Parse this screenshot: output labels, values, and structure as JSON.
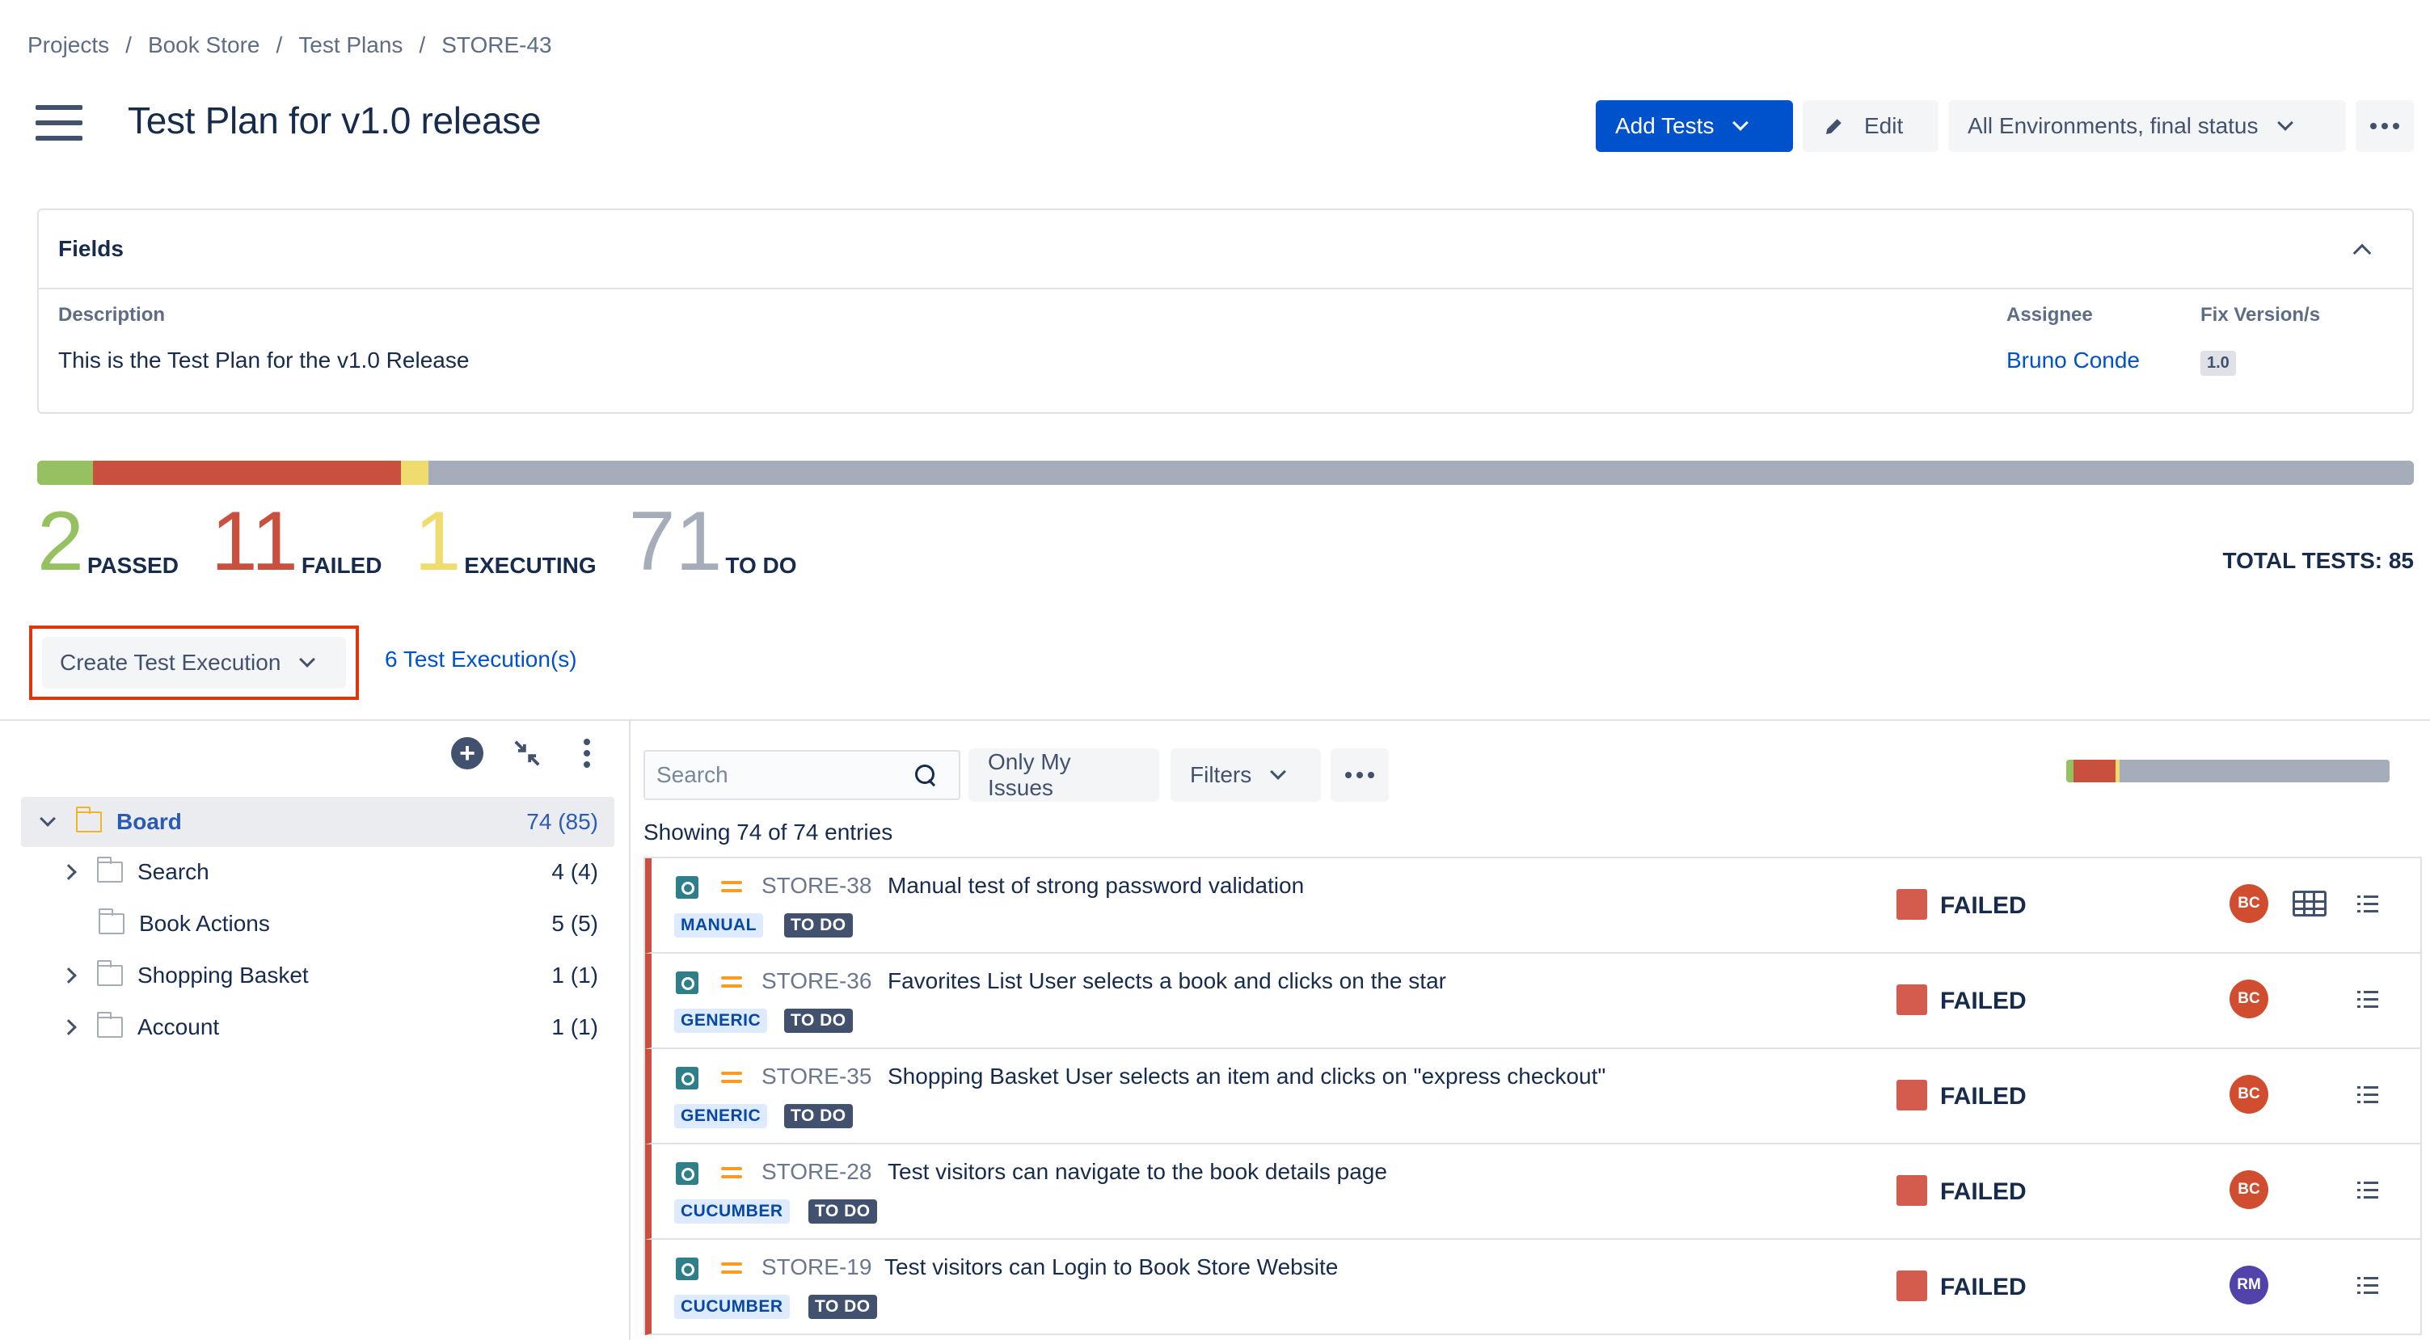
{
  "breadcrumb": {
    "items": [
      "Projects",
      "Book Store",
      "Test Plans",
      "STORE-43"
    ],
    "separator": "/"
  },
  "header": {
    "title": "Test Plan for v1.0 release",
    "add_tests_label": "Add Tests",
    "edit_label": "Edit",
    "environment_select": "All Environments, final status"
  },
  "fields": {
    "title": "Fields",
    "description_label": "Description",
    "description_value": "This is the Test Plan for the v1.0 Release",
    "assignee_label": "Assignee",
    "assignee_value": "Bruno Conde",
    "fix_version_label": "Fix Version/s",
    "fix_version_value": "1.0"
  },
  "summary": {
    "passed_count": "2",
    "passed_label": "PASSED",
    "failed_count": "11",
    "failed_label": "FAILED",
    "executing_count": "1",
    "executing_label": "EXECUTING",
    "todo_count": "71",
    "todo_label": "TO DO",
    "total_label": "TOTAL TESTS: 85",
    "colors": {
      "passed": "#95c160",
      "failed": "#c9503f",
      "executing": "#f0dc6e",
      "todo": "#a5adba"
    }
  },
  "executions": {
    "create_label": "Create Test Execution",
    "count_link": "6 Test Execution(s)"
  },
  "tree": {
    "items": [
      {
        "label": "Board",
        "count": "74 (85)",
        "expandable": true,
        "expanded": true
      },
      {
        "label": "Search",
        "count": "4 (4)",
        "expandable": true,
        "expanded": false
      },
      {
        "label": "Book Actions",
        "count": "5 (5)",
        "expandable": false,
        "expanded": false
      },
      {
        "label": "Shopping Basket",
        "count": "1 (1)",
        "expandable": true,
        "expanded": false
      },
      {
        "label": "Account",
        "count": "1 (1)",
        "expandable": true,
        "expanded": false
      }
    ]
  },
  "tests_toolbar": {
    "search_placeholder": "Search",
    "only_my_issues_label": "Only My Issues",
    "filters_label": "Filters",
    "showing_text": "Showing 74 of 74 entries"
  },
  "tests": [
    {
      "key": "STORE-38",
      "summary": "Manual test of strong password validation",
      "type": "MANUAL",
      "status": "TO DO",
      "result": "FAILED",
      "assignee": "BC",
      "avatar_color": "#d04e2f",
      "has_dataset": true
    },
    {
      "key": "STORE-36",
      "summary": "Favorites List User selects a book and clicks on the star",
      "type": "GENERIC",
      "status": "TO DO",
      "result": "FAILED",
      "assignee": "BC",
      "avatar_color": "#d04e2f",
      "has_dataset": false
    },
    {
      "key": "STORE-35",
      "summary": "Shopping Basket User selects an item and clicks on \"express checkout\"",
      "type": "GENERIC",
      "status": "TO DO",
      "result": "FAILED",
      "assignee": "BC",
      "avatar_color": "#d04e2f",
      "has_dataset": false
    },
    {
      "key": "STORE-28",
      "summary": "Test visitors can navigate to the book details page",
      "type": "CUCUMBER",
      "status": "TO DO",
      "result": "FAILED",
      "assignee": "BC",
      "avatar_color": "#d04e2f",
      "has_dataset": false
    },
    {
      "key": "STORE-19",
      "summary": "Test visitors can Login to Book Store Website",
      "type": "CUCUMBER",
      "status": "TO DO",
      "result": "FAILED",
      "assignee": "RM",
      "avatar_color": "#5243aa",
      "has_dataset": false
    }
  ]
}
